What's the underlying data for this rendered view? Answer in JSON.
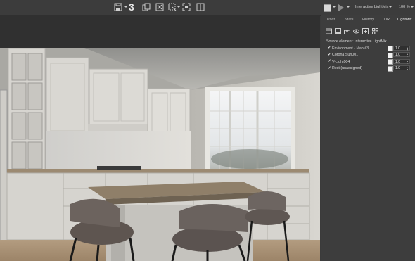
{
  "toolbar": {
    "history_count": "3",
    "lightmix_label": "Interactive LightMix",
    "zoom_label": "100 %",
    "icons": [
      "save-icon",
      "copy-icon",
      "clear-icon",
      "region-select-icon",
      "fit-region-icon",
      "compare-icon",
      "color-swatch-icon",
      "render-play-icon"
    ]
  },
  "panel": {
    "tabs": [
      {
        "label": "Post",
        "active": false
      },
      {
        "label": "Stats",
        "active": false
      },
      {
        "label": "History",
        "active": false
      },
      {
        "label": "DR",
        "active": false
      },
      {
        "label": "LightMix",
        "active": true
      }
    ],
    "source_label": "Source element: Interactive LightMix",
    "lights": [
      {
        "checked": true,
        "name": "Environment - Map #3",
        "value": "1.0",
        "color": "#f2f2f2"
      },
      {
        "checked": true,
        "name": "Corona Sun001",
        "value": "1.0",
        "color": "#f2f2f2"
      },
      {
        "checked": true,
        "name": "V-Light004",
        "value": "1.0",
        "color": "#f2f2f2"
      },
      {
        "checked": true,
        "name": "Rest (unassigned)",
        "value": "1.0",
        "color": "#f2f2f2"
      }
    ]
  },
  "render": {
    "description_icon": "kitchen-render-image"
  }
}
